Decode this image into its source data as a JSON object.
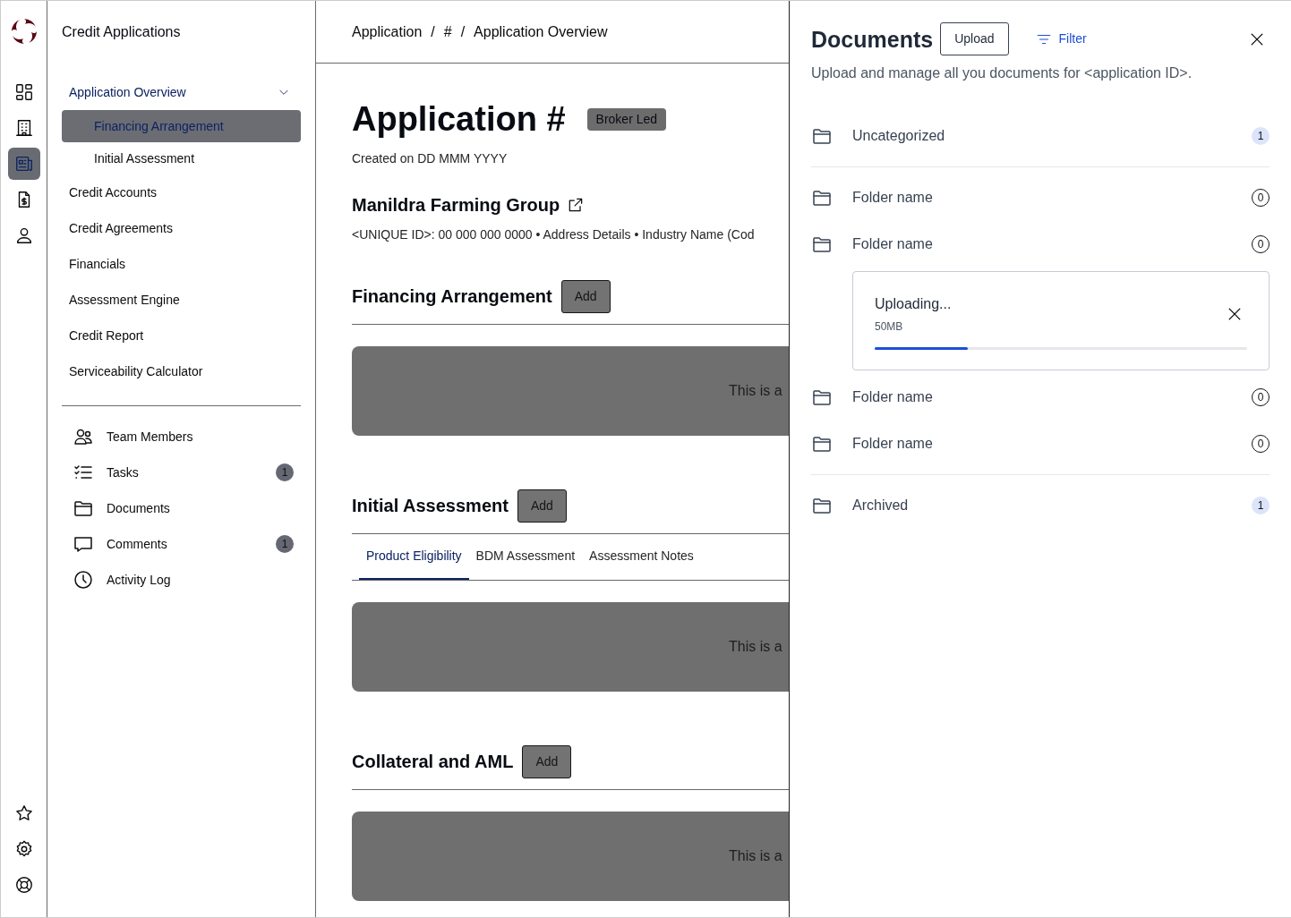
{
  "app": {
    "title": "Credit Applications"
  },
  "rail": [
    {
      "selected": false
    },
    {
      "selected": false
    },
    {
      "selected": true
    },
    {
      "selected": false
    },
    {
      "selected": false
    }
  ],
  "sidebar": {
    "items": [
      {
        "label": "Application Overview",
        "selected": false,
        "expanded": true,
        "children": [
          {
            "label": "Financing Arrangement",
            "selected": true
          },
          {
            "label": "Initial Assessment",
            "selected": false
          }
        ]
      },
      {
        "label": "Credit Accounts",
        "selected": false
      },
      {
        "label": "Credit Agreements",
        "selected": false
      },
      {
        "label": "Financials",
        "selected": false
      },
      {
        "label": "Assessment Engine",
        "selected": false
      },
      {
        "label": "Credit Report",
        "selected": false
      },
      {
        "label": "Serviceability Calculator",
        "selected": false
      }
    ],
    "tools": [
      {
        "label": "Team Members"
      },
      {
        "label": "Tasks",
        "count": "1"
      },
      {
        "label": "Documents"
      },
      {
        "label": "Comments",
        "count": "1"
      },
      {
        "label": "Activity Log"
      }
    ]
  },
  "breadcrumb": [
    "Application",
    "#",
    "Application Overview"
  ],
  "breadcrumb_separators": [
    "/",
    "/"
  ],
  "page": {
    "title": "Application #",
    "badge": "Broker Led",
    "created": "Created on DD MMM YYYY",
    "company": "Manildra Farming Group",
    "details": "<UNIQUE ID>: 00 000 000 0000 • Address Details • Industry Name (Cod",
    "sections": [
      {
        "title": "Financing Arrangement",
        "button": "Add",
        "placeholder": "This is a"
      },
      {
        "title": "Initial Assessment",
        "button": "Add",
        "tabs": [
          {
            "label": "Product Eligibility",
            "selected": true
          },
          {
            "label": "BDM Assessment",
            "selected": false
          },
          {
            "label": "Assessment Notes",
            "selected": false
          }
        ],
        "placeholder": "This is a"
      },
      {
        "title": "Collateral and AML",
        "button": "Add",
        "placeholder": "This is a"
      }
    ]
  },
  "drawer": {
    "title": "Documents",
    "upload_button": "Upload",
    "filter_button": "Filter",
    "description": "Upload and manage all you documents for <application ID>.",
    "groups": [
      [
        {
          "kind": "folder",
          "name": "Uncategorized",
          "count": "1",
          "highlighted": true
        }
      ],
      [
        {
          "kind": "folder",
          "name": "Folder name",
          "count": "0",
          "highlighted": false
        },
        {
          "kind": "folder",
          "name": "Folder name",
          "count": "0",
          "highlighted": false
        },
        {
          "kind": "upload",
          "title": "Uploading...",
          "size": "50MB",
          "level": 0.25
        },
        {
          "kind": "folder",
          "name": "Folder name",
          "count": "0",
          "highlighted": false
        },
        {
          "kind": "folder",
          "name": "Folder name",
          "count": "0",
          "highlighted": false
        }
      ],
      [
        {
          "kind": "folder",
          "name": "Archived",
          "count": "1",
          "highlighted": true
        }
      ]
    ]
  }
}
